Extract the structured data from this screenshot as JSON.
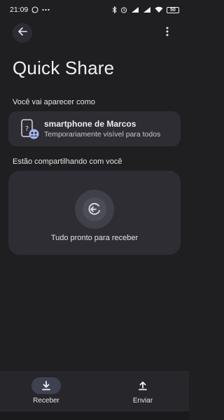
{
  "status_bar": {
    "time": "21:09",
    "battery": "50",
    "left_icons": [
      "whatsapp-icon",
      "more-dots-icon"
    ],
    "right_icons": [
      "bluetooth-icon",
      "alarm-icon",
      "signal-5g-icon",
      "signal-icon",
      "wifi-icon",
      "battery-icon"
    ]
  },
  "toolbar": {
    "back_icon": "arrow-back-icon",
    "menu_icon": "more-vert-icon"
  },
  "page": {
    "title": "Quick Share"
  },
  "visibility_section": {
    "label": "Você vai aparecer como",
    "device_name": "smartphone de Marcos",
    "device_status": "Temporariamente visível para todos",
    "device_icon": "phone-people-icon"
  },
  "sharing_section": {
    "label": "Estão compartilhando com você",
    "status": "Tudo pronto para receber",
    "icon": "receive-pulse-icon"
  },
  "bottom_nav": {
    "items": [
      {
        "label": "Receber",
        "icon": "download-icon",
        "active": true
      },
      {
        "label": "Enviar",
        "icon": "upload-icon",
        "active": false
      }
    ]
  },
  "colors": {
    "background": "#1f1f22",
    "card": "#2d2d33",
    "active_pill": "#3e4150",
    "text": "#e6e6ea"
  }
}
